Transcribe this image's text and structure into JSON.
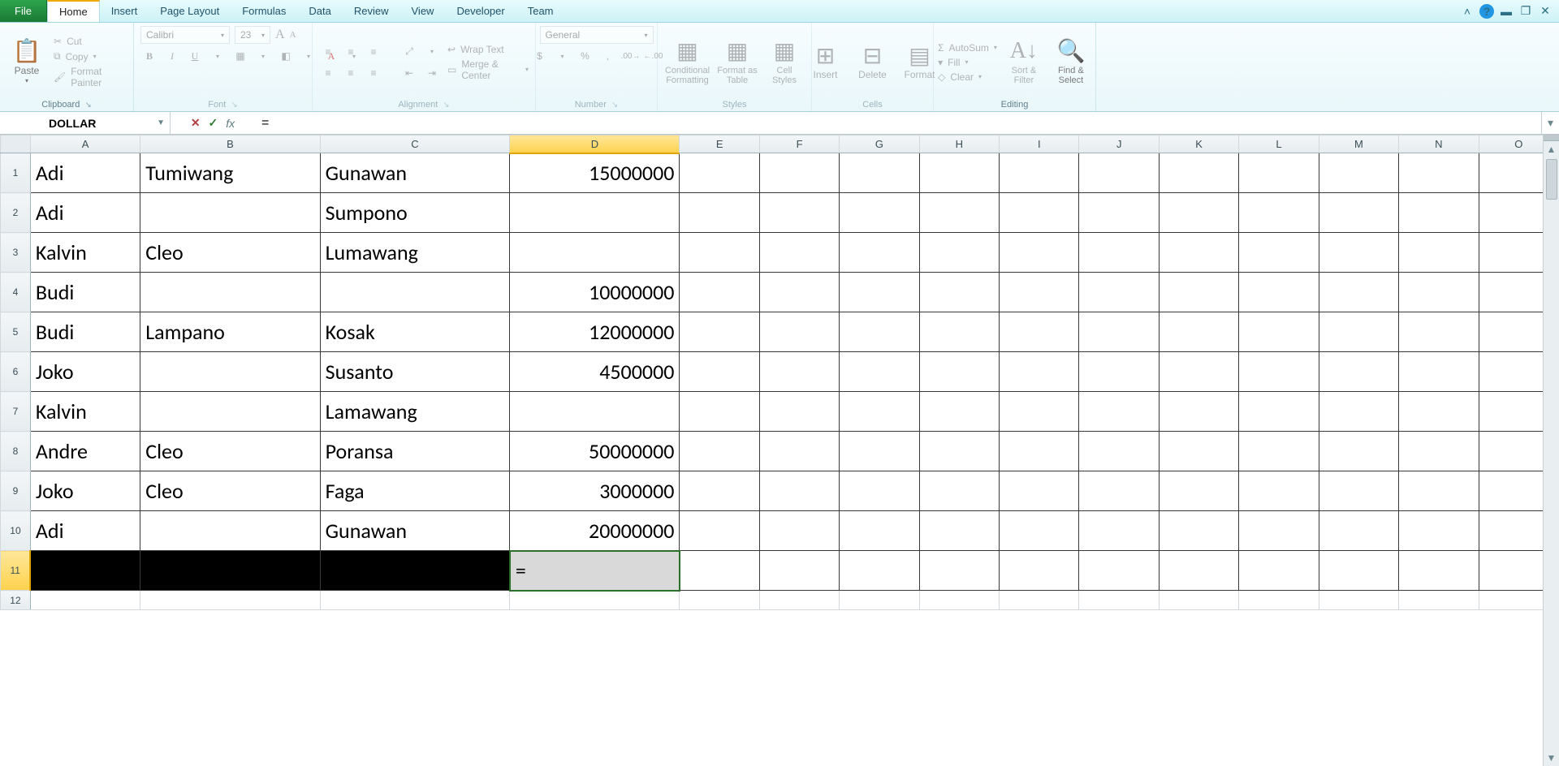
{
  "menu": {
    "file": "File",
    "tabs": [
      "Home",
      "Insert",
      "Page Layout",
      "Formulas",
      "Data",
      "Review",
      "View",
      "Developer",
      "Team"
    ],
    "active": "Home"
  },
  "ribbon": {
    "clipboard": {
      "paste": "Paste",
      "cut": "Cut",
      "copy": "Copy",
      "fp": "Format Painter",
      "label": "Clipboard"
    },
    "font": {
      "name": "Calibri",
      "size": "23",
      "label": "Font"
    },
    "alignment": {
      "wrap": "Wrap Text",
      "merge": "Merge & Center",
      "label": "Alignment"
    },
    "number": {
      "format": "General",
      "label": "Number"
    },
    "styles": {
      "cond": "Conditional Formatting",
      "table": "Format as Table",
      "cell": "Cell Styles",
      "label": "Styles"
    },
    "cells": {
      "insert": "Insert",
      "delete": "Delete",
      "format": "Format",
      "label": "Cells"
    },
    "editing": {
      "autosum": "AutoSum",
      "fill": "Fill",
      "clear": "Clear",
      "sort": "Sort & Filter",
      "find": "Find & Select",
      "label": "Editing"
    }
  },
  "formula_bar": {
    "name_box": "DOLLAR",
    "formula": "="
  },
  "columns": [
    "A",
    "B",
    "C",
    "D",
    "E",
    "F",
    "G",
    "H",
    "I",
    "J",
    "K",
    "L",
    "M",
    "N",
    "O"
  ],
  "selected_col": "D",
  "selected_row": 11,
  "data_rows": [
    {
      "A": "Adi",
      "B": "Tumiwang",
      "C": "Gunawan",
      "D": "15000000"
    },
    {
      "A": "Adi",
      "B": "",
      "C": "Sumpono",
      "D": ""
    },
    {
      "A": "Kalvin",
      "B": "Cleo",
      "C": "Lumawang",
      "D": ""
    },
    {
      "A": "Budi",
      "B": "",
      "C": "",
      "D": "10000000"
    },
    {
      "A": "Budi",
      "B": "Lampano",
      "C": "Kosak",
      "D": "12000000"
    },
    {
      "A": "Joko",
      "B": "",
      "C": "Susanto",
      "D": "4500000"
    },
    {
      "A": "Kalvin",
      "B": "",
      "C": "Lamawang",
      "D": ""
    },
    {
      "A": "Andre",
      "B": "Cleo",
      "C": "Poransa",
      "D": "50000000"
    },
    {
      "A": "Joko",
      "B": "Cleo",
      "C": "Faga",
      "D": "3000000"
    },
    {
      "A": "Adi",
      "B": "",
      "C": "Gunawan",
      "D": "20000000"
    }
  ],
  "active_cell_content": "=",
  "extra_rows": [
    12
  ]
}
